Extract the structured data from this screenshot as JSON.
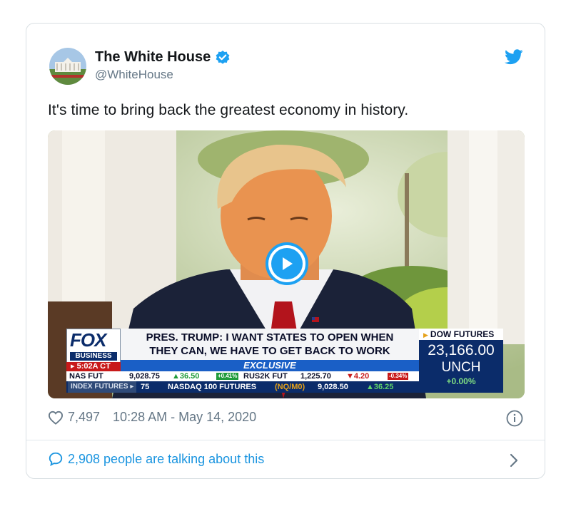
{
  "tweet": {
    "display_name": "The White House",
    "handle": "@WhiteHouse",
    "text": "It's time to bring back the greatest economy in history.",
    "likes": "7,497",
    "timestamp": "10:28 AM - May 14, 2020",
    "talking": "2,908 people are talking about this"
  },
  "icons": {
    "verified": "verified-badge-icon",
    "brand": "twitter-bird-icon",
    "like": "heart-icon",
    "info": "info-icon",
    "comment": "speech-bubble-icon",
    "chevron": "chevron-right-icon",
    "play": "play-icon"
  },
  "video": {
    "logo_top": "FOX",
    "logo_bottom": "BUSINESS",
    "time": "▸ 5:02A CT",
    "headline_line1": "PRES. TRUMP: I WANT STATES TO OPEN WHEN",
    "headline_line2": "THEY CAN, WE HAVE TO GET BACK TO WORK",
    "exclusive": "EXCLUSIVE",
    "ticker1": {
      "nas_label": "NAS FUT",
      "nas_value": "9,028.75",
      "nas_change": "▲36.50",
      "nas_pct": "+0.41%",
      "rus_label": "RUS2K FUT",
      "rus_value": "1,225.70",
      "rus_change": "▼4.20",
      "rus_pct": "-0.34%"
    },
    "ticker2": {
      "index_label": "INDEX FUTURES ▸",
      "left_value": "75",
      "nasdaq_label": "NASDAQ 100 FUTURES",
      "nasdaq_code": "(NQ/M0)",
      "nasdaq_value": "9,028.50",
      "nasdaq_change": "▲36.25"
    },
    "dow": {
      "label": "DOW FUTURES",
      "value": "23,166.00",
      "change": "UNCH",
      "pct": "+0.00%"
    }
  },
  "colors": {
    "twitter_blue": "#1da1f2",
    "link_blue": "#1b95e0",
    "muted_text": "#657786",
    "fox_navy": "#0b2c6a",
    "fox_red": "#c81a1a",
    "fox_blue": "#1a5fc6"
  }
}
